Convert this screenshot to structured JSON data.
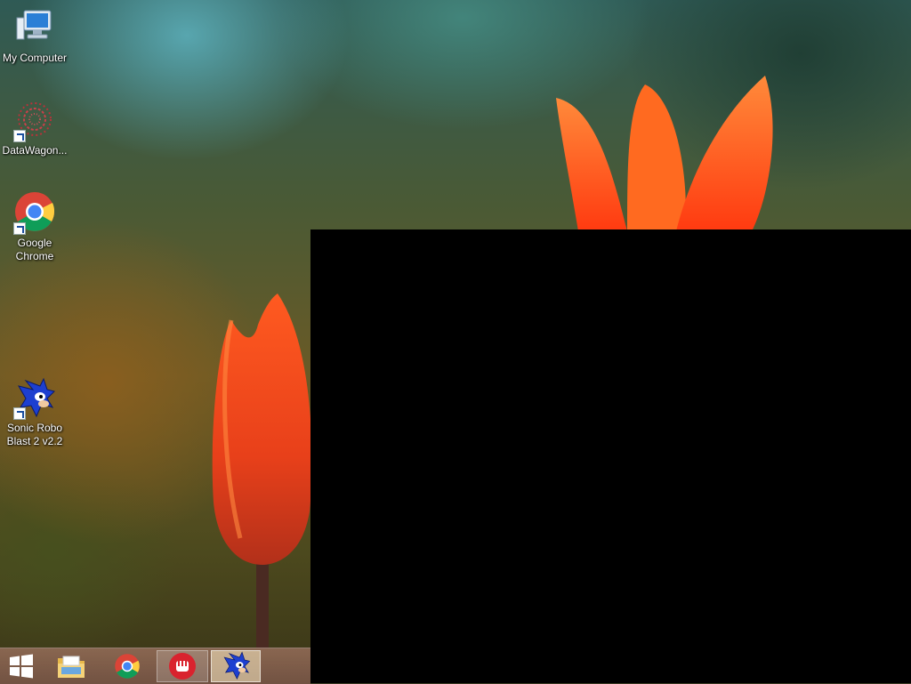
{
  "desktop": {
    "icons": [
      {
        "label": "My Computer",
        "icon": "computer-icon"
      },
      {
        "label": "DataWagon...",
        "icon": "datawagon-icon"
      },
      {
        "label": "Google Chrome",
        "icon": "chrome-icon"
      },
      {
        "label": "Sonic Robo Blast 2 v2.2",
        "icon": "sonic-icon"
      }
    ]
  },
  "taskbar": {
    "items": [
      {
        "name": "start",
        "icon": "windows-logo-icon"
      },
      {
        "name": "file-explorer",
        "icon": "folder-icon"
      },
      {
        "name": "google-chrome",
        "icon": "chrome-icon"
      },
      {
        "name": "red-app",
        "icon": "fist-icon"
      },
      {
        "name": "sonic-robo-blast-2",
        "icon": "sonic-icon"
      }
    ]
  },
  "colors": {
    "taskbar": "#8c6a58",
    "panel": "#000000",
    "flower": "#ff5a1f"
  }
}
